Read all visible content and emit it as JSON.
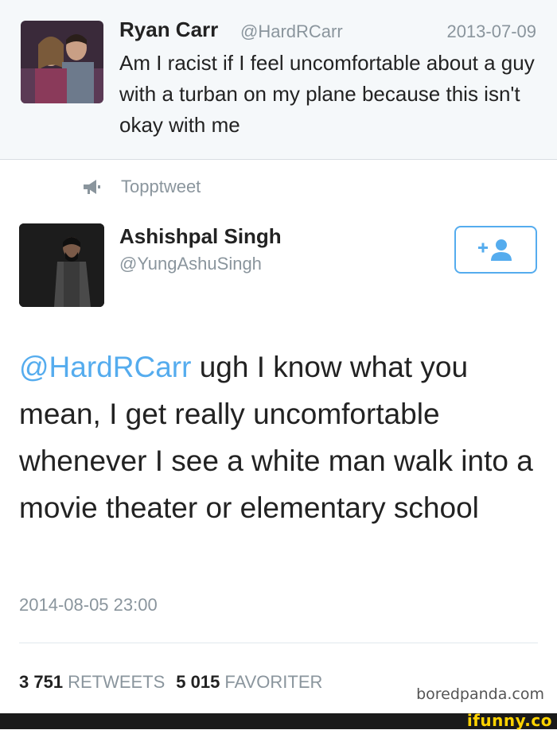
{
  "reply": {
    "name": "Ryan Carr",
    "handle": "@HardRCarr",
    "date": "2013-07-09",
    "text": "Am I racist if I feel uncomfortable about a guy with a turban on my plane because this isn't okay with me"
  },
  "topptweet": {
    "label": "Topptweet",
    "icon": "megaphone-icon"
  },
  "tweet": {
    "name": "Ashishpal Singh",
    "handle": "@YungAshuSingh",
    "mention": "@HardRCarr",
    "body": " ugh I know what you mean, I get really uncomfortable whenever I see a white man walk into a movie theater or elementary school",
    "timestamp": "2014-08-05 23:00",
    "follow_icon": "add-user-icon"
  },
  "stats": {
    "retweets_count": "3 751",
    "retweets_label": "RETWEETS",
    "favorites_count": "5 015",
    "favorites_label": "FAVORITER"
  },
  "watermarks": {
    "boredpanda": "boredpanda.com",
    "ifunny": "ifunny.co"
  },
  "colors": {
    "accent": "#55acee",
    "muted": "#8a959d",
    "reply_bg": "#f5f8fa",
    "ifunny": "#ffd300"
  }
}
